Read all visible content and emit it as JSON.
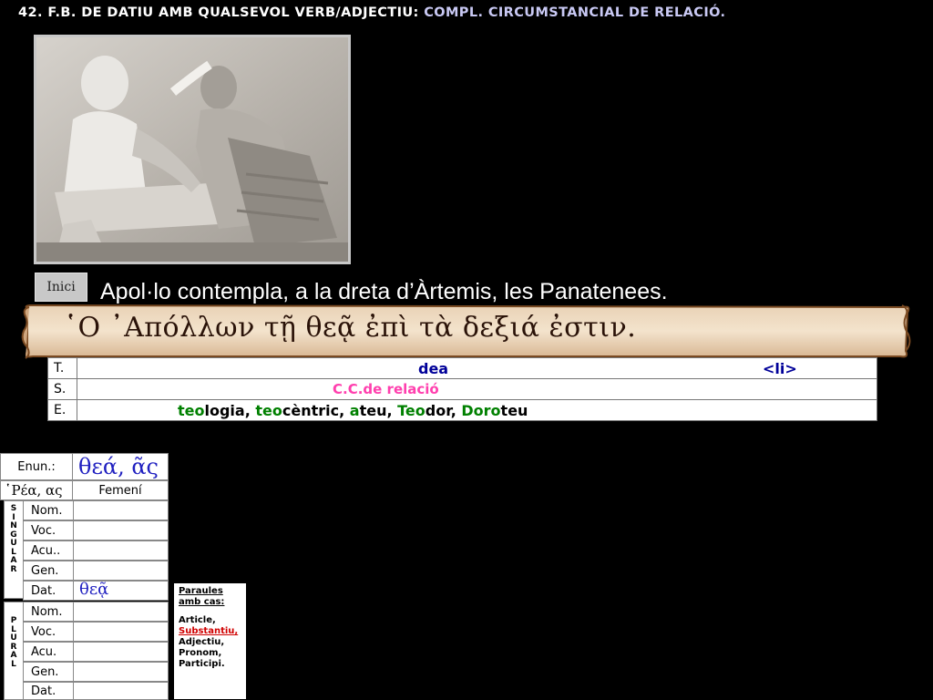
{
  "header": {
    "title_part1": "42. F.B. DE DATIU AMB QUALSEVOL VERB/ADJECTIU:",
    "title_part2": "COMPL. CIRCUMSTANCIAL DE RELACIÓ."
  },
  "inici_label": "Inici",
  "sentence": "Apol·lo contempla, a la dreta d’Àrtemis, les Panatenees.",
  "greek_sentence": "῾Ο ᾿Απόλλων τῇ θεᾷ ἐπὶ τὰ δεξιά ἐστιν.",
  "tse": {
    "labels": [
      "T.",
      "S.",
      "E."
    ],
    "t_word": "dea",
    "t_tag": "<li>",
    "s_text": "C.C.de relació",
    "e_words": [
      {
        "a": "teo",
        "b": "logia"
      },
      {
        "a": "teo",
        "b": "cèntric"
      },
      {
        "a": "a",
        "b": "teu"
      },
      {
        "a": "Teo",
        "b": "dor"
      },
      {
        "a": "Doro",
        "b": "teu"
      }
    ],
    "e_text": "teologia, teocèntric, ateu, Teodor, Doroteu"
  },
  "declension": {
    "enun_label": "Enun.:",
    "enun_value": "θεά, ᾶς",
    "model": "῾Ρέα, ας",
    "gender": "Femení",
    "singular_label": "SINGULAR",
    "plural_label": "PLURAL",
    "cases": [
      "Nom.",
      "Voc.",
      "Acu..",
      "Gen.",
      "Dat."
    ],
    "plural_cases": [
      "Nom.",
      "Voc.",
      "Acu.",
      "Gen.",
      "Dat."
    ],
    "dat_sg_value": "θεᾷ"
  },
  "note": {
    "line1": "Paraules",
    "line2": "amb cas:",
    "items": [
      "Article,",
      "Substantiu,",
      "Adjectiu,",
      "Pronom,",
      "Participi."
    ]
  },
  "colors": {
    "title": "#ffffff",
    "title_accent": "#c9c9f4",
    "dea": "#000099",
    "cc": "#ff3fae",
    "etymology_green": "#008000",
    "note_red": "#d00000"
  }
}
